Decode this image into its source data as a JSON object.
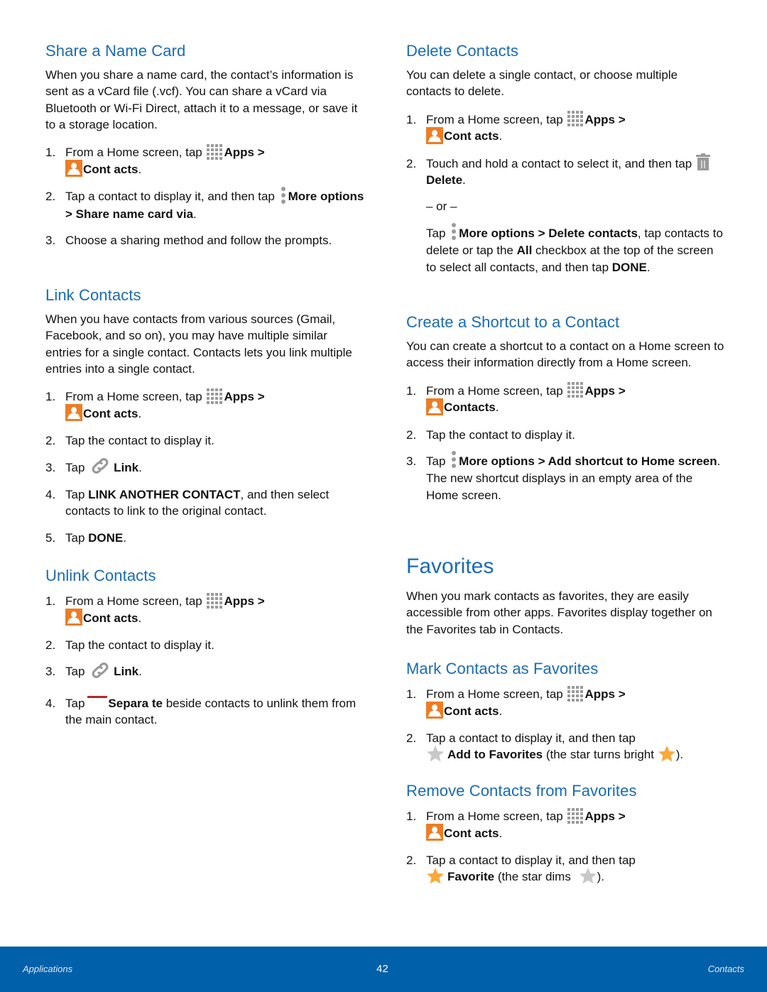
{
  "colors": {
    "heading": "#1a6bb5",
    "footer_bg": "#0060a9",
    "contacts_icon": "#f07c22",
    "icon_gray": "#9a9a9a",
    "separate_red": "#b22a2a",
    "star_bright": "#f9a93a",
    "star_dim": "#c8c8c8"
  },
  "icons": {
    "apps": "apps-grid-icon",
    "contacts": "contacts-person-icon",
    "more": "more-options-vertical-dots-icon",
    "trash": "trash-icon",
    "link": "link-chain-icon",
    "separate": "separate-minus-icon",
    "star_bright": "star-bright-icon",
    "star_dim": "star-dim-icon"
  },
  "share": {
    "title": "Share a Name Card",
    "intro": "When you share a name card, the contact’s information is sent as a vCard file (.vcf). You can share a vCard via Bluetooth or Wi-Fi Direct, attach it to a message, or save it to a storage location.",
    "steps": [
      {
        "num": "1.",
        "pre": "From a Home screen, tap",
        "apps": "Apps",
        "gt": " >",
        "contacts": "Cont acts",
        "end": "."
      },
      {
        "num": "2.",
        "pre": "Tap a contact to display it, and then tap",
        "bold": "More options > Share name card via",
        "end": "."
      },
      {
        "num": "3.",
        "text": "Choose a sharing method and follow the prompts."
      }
    ]
  },
  "link": {
    "title": "Link Contacts",
    "intro": "When you have contacts from various sources (Gmail, Facebook, and so on), you may have multiple similar entries for a single contact. Contacts lets you link multiple entries into a single contact.",
    "steps": [
      {
        "num": "1.",
        "pre": "From a Home screen, tap",
        "apps": "Apps",
        "gt": " >",
        "contacts": "Cont acts",
        "end": "."
      },
      {
        "num": "2.",
        "text": "Tap the contact to display it."
      },
      {
        "num": "3.",
        "pre": "Tap",
        "bold": "Link",
        "end": "."
      },
      {
        "num": "4.",
        "pre": "Tap ",
        "bold": "LINK ANOTHER CONTACT",
        "post": ", and then select contacts to link to the original contact."
      },
      {
        "num": "5.",
        "pre": "Tap ",
        "bold": "DONE",
        "end": "."
      }
    ]
  },
  "unlink": {
    "title": "Unlink Contacts",
    "steps": [
      {
        "num": "1.",
        "pre": "From a Home screen, tap",
        "apps": "Apps",
        "gt": " >",
        "contacts": "Cont acts",
        "end": "."
      },
      {
        "num": "2.",
        "text": "Tap the contact to display it."
      },
      {
        "num": "3.",
        "pre": "Tap",
        "bold": "Link",
        "end": "."
      },
      {
        "num": "4.",
        "pre": "Tap",
        "bold": "Separa te",
        "post": " beside contacts to unlink them from the main contact."
      }
    ]
  },
  "delete": {
    "title": "Delete Contacts",
    "intro": "You can delete a single contact, or choose multiple contacts to delete.",
    "steps": [
      {
        "num": "1.",
        "pre": "From a Home screen, tap",
        "apps": "Apps",
        "gt": " >",
        "contacts": "Cont acts",
        "end": "."
      },
      {
        "num": "2.",
        "pre": "Touch and hold a contact to select it, and then tap",
        "bold": "Delete",
        "end": "."
      }
    ],
    "or": "– or –",
    "alt": {
      "pre": "Tap",
      "bold1": "More options > Delete contacts",
      "mid1": ", tap contacts to delete or tap the ",
      "bold2": "All",
      "mid2": " checkbox at the top of the screen to select all contacts, and then tap ",
      "bold3": "DONE",
      "end": "."
    }
  },
  "shortcut": {
    "title": "Create a Shortcut to a Contact",
    "intro": "You can create a shortcut to a contact on a Home screen to access their information directly from a Home screen.",
    "steps": [
      {
        "num": "1.",
        "pre": "From a Home screen, tap",
        "apps": "Apps",
        "gt": " >",
        "contacts": "Contacts",
        "end": "."
      },
      {
        "num": "2.",
        "text": "Tap the contact to display it."
      },
      {
        "num": "3.",
        "pre": "Tap",
        "bold": "More options > Add shortcut to Home screen",
        "post": ". The new shortcut displays in an empty area of the Home screen."
      }
    ]
  },
  "favorites": {
    "title": "Favorites",
    "intro": "When you mark contacts as favorites, they are easily accessible from other apps. Favorites display together on the Favorites tab in Contacts."
  },
  "mark": {
    "title": "Mark Contacts as Favorites",
    "steps": [
      {
        "num": "1.",
        "pre": "From a Home screen, tap",
        "apps": "Apps",
        "gt": " >",
        "contacts": "Cont acts",
        "end": "."
      },
      {
        "num": "2.",
        "pre": "Tap a contact to display it, and then tap",
        "bold": "Add to Favorites",
        "post": " (the star turns bright ",
        "end": ")."
      }
    ]
  },
  "remove": {
    "title": "Remove Contacts from Favorites",
    "steps": [
      {
        "num": "1.",
        "pre": "From a Home screen, tap",
        "apps": "Apps",
        "gt": " >",
        "contacts": "Cont acts",
        "end": "."
      },
      {
        "num": "2.",
        "pre": "Tap a contact to display it, and then tap",
        "bold": "Favorite",
        "post": " (the star dims ",
        "end": ")."
      }
    ]
  },
  "footer": {
    "left": "Applications",
    "page": "42",
    "right": "Contacts"
  }
}
